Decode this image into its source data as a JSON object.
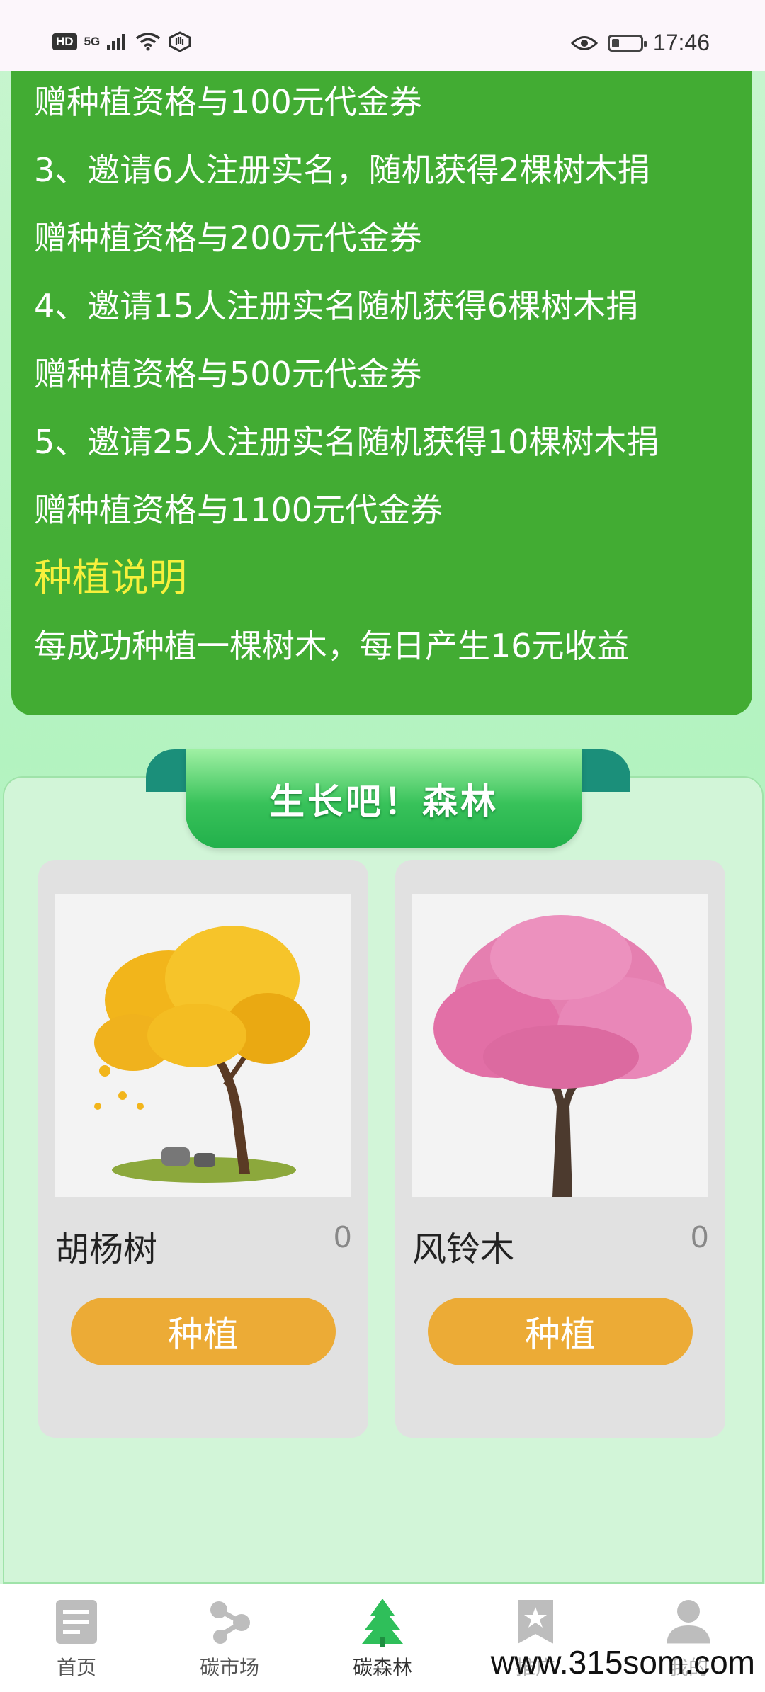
{
  "status_bar": {
    "hd": "HD",
    "network": "5G",
    "time": "17:46"
  },
  "rules": {
    "lines": [
      "赠种植资格与100元代金券",
      "3、邀请6人注册实名，随机获得2棵树木捐",
      "赠种植资格与200元代金券",
      "4、邀请15人注册实名随机获得6棵树木捐",
      "赠种植资格与500元代金券",
      "5、邀请25人注册实名随机获得10棵树木捐",
      "赠种植资格与1100元代金券"
    ],
    "planting_title": "种植说明",
    "planting_desc": "每成功种植一棵树木，每日产生16元收益"
  },
  "forest": {
    "banner_title": "生长吧！森林",
    "trees": [
      {
        "name": "胡杨树",
        "count": "0",
        "button": "种植",
        "color": "#f2b51b",
        "icon": "yellow-tree-image"
      },
      {
        "name": "风铃木",
        "count": "0",
        "button": "种植",
        "color": "#e57fb0",
        "icon": "pink-tree-image"
      }
    ]
  },
  "nav": {
    "items": [
      {
        "label": "首页",
        "icon": "document-icon"
      },
      {
        "label": "碳市场",
        "icon": "share-nodes-icon"
      },
      {
        "label": "碳森林",
        "icon": "pine-tree-icon"
      },
      {
        "label": "推广",
        "icon": "bookmark-star-icon"
      },
      {
        "label": "我的",
        "icon": "user-icon"
      }
    ],
    "active_color": "#2fbf5a",
    "inactive_color": "#bdbdbd"
  },
  "watermark": "www.315som.com"
}
